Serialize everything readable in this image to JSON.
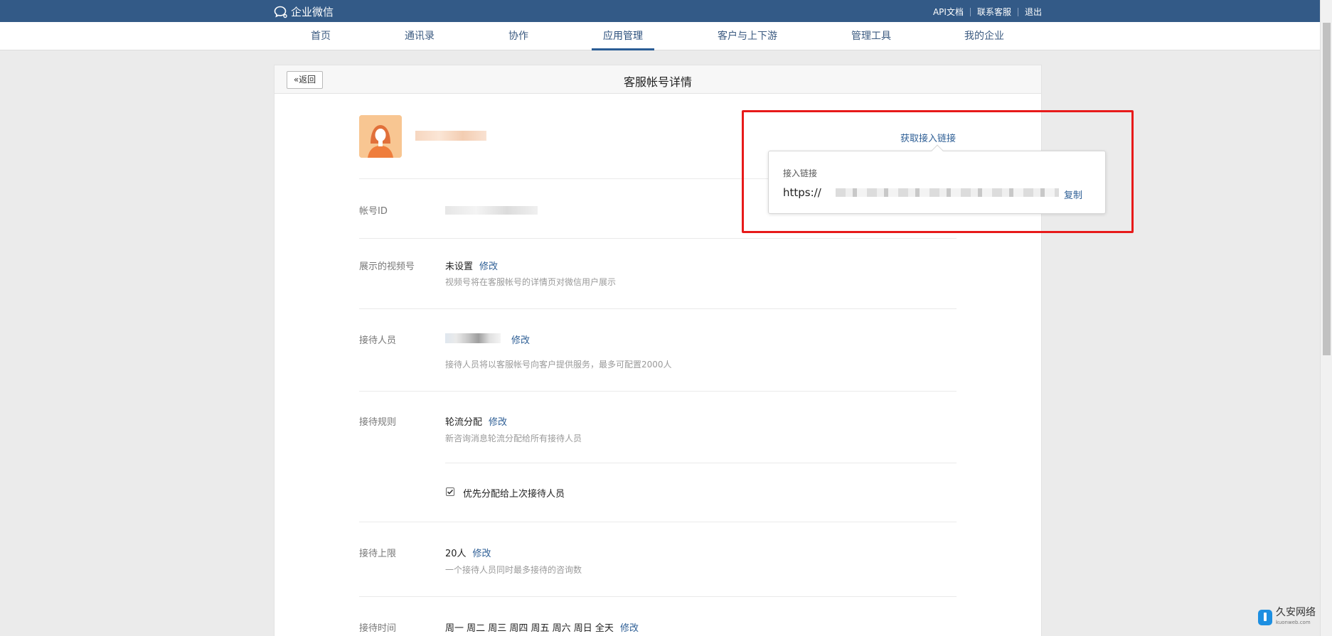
{
  "colors": {
    "brand": "#335a87",
    "link": "#2d5e95",
    "highlight": "#e71a1a"
  },
  "topbar": {
    "logo_text": "企业微信",
    "links": [
      "API文档",
      "联系客服",
      "退出"
    ]
  },
  "nav": {
    "items": [
      "首页",
      "通讯录",
      "协作",
      "应用管理",
      "客户与上下游",
      "管理工具",
      "我的企业"
    ],
    "active": "应用管理"
  },
  "card": {
    "back_label": "返回",
    "title": "客服帐号详情"
  },
  "fields": {
    "account_id": {
      "label": "帐号ID"
    },
    "video": {
      "label": "展示的视频号",
      "value": "未设置",
      "action": "修改",
      "hint": "视频号将在客服帐号的详情页对微信用户展示"
    },
    "staff": {
      "label": "接待人员",
      "action": "修改",
      "hint": "接待人员将以客服帐号向客户提供服务，最多可配置2000人"
    },
    "rule": {
      "label": "接待规则",
      "value": "轮流分配",
      "action": "修改",
      "hint": "新咨询消息轮流分配给所有接待人员"
    },
    "priority": {
      "label": "优先分配给上次接待人员",
      "checked": true
    },
    "limit": {
      "label": "接待上限",
      "value": "20人",
      "action": "修改",
      "hint": "一个接待人员同时最多接待的咨询数"
    },
    "time": {
      "label": "接待时间",
      "value": "周一 周二 周三 周四 周五 周六 周日 全天",
      "action": "修改"
    }
  },
  "popover": {
    "trigger": "获取接入链接",
    "title": "接入链接",
    "url_prefix": "https://",
    "copy": "复制"
  },
  "watermark": {
    "name": "久安网络",
    "domain": "kuonweb.com"
  }
}
